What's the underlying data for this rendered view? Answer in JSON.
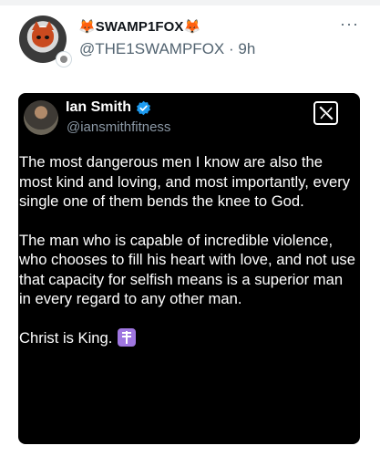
{
  "post": {
    "author_name": "SWAMP1FOX",
    "author_emoji_left": "🦊",
    "author_emoji_right": "🦊",
    "handle": "@THE1SWAMPFOX",
    "separator": "·",
    "time": "9h",
    "more_label": "···"
  },
  "embedded": {
    "name": "Ian Smith",
    "handle": "@iansmithfitness",
    "paragraph1": "The most dangerous men I know are also the most kind and loving, and most importantly, every single one of them bends the knee to God.",
    "paragraph2": "The man who is capable of incredible violence, who chooses to fill his heart with love, and not use that capacity for selfish means is a superior man in every regard to any other man.",
    "paragraph3": "Christ is King.",
    "badge_color": "#1d9bf0",
    "emoji_color": "#9f76e0"
  }
}
